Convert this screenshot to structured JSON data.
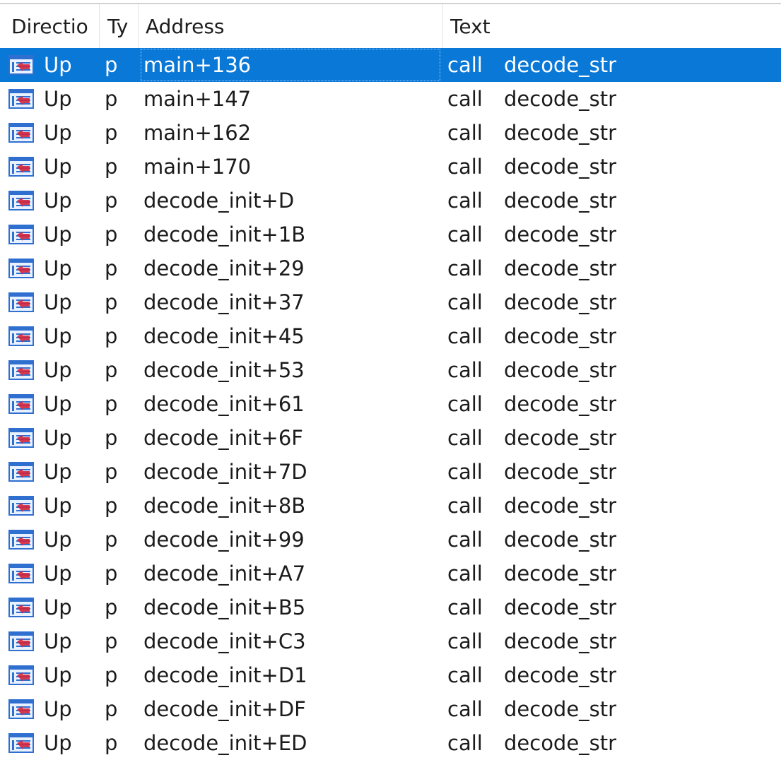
{
  "columns": {
    "direction": "Directio",
    "type": "Ty",
    "address": "Address",
    "text": "Text"
  },
  "icon": "xref-code-icon",
  "selected_index": 0,
  "rows": [
    {
      "direction": "Up",
      "type": "p",
      "address": "main+136",
      "op": "call",
      "arg": "decode_str"
    },
    {
      "direction": "Up",
      "type": "p",
      "address": "main+147",
      "op": "call",
      "arg": "decode_str"
    },
    {
      "direction": "Up",
      "type": "p",
      "address": "main+162",
      "op": "call",
      "arg": "decode_str"
    },
    {
      "direction": "Up",
      "type": "p",
      "address": "main+170",
      "op": "call",
      "arg": "decode_str"
    },
    {
      "direction": "Up",
      "type": "p",
      "address": "decode_init+D",
      "op": "call",
      "arg": "decode_str"
    },
    {
      "direction": "Up",
      "type": "p",
      "address": "decode_init+1B",
      "op": "call",
      "arg": "decode_str"
    },
    {
      "direction": "Up",
      "type": "p",
      "address": "decode_init+29",
      "op": "call",
      "arg": "decode_str"
    },
    {
      "direction": "Up",
      "type": "p",
      "address": "decode_init+37",
      "op": "call",
      "arg": "decode_str"
    },
    {
      "direction": "Up",
      "type": "p",
      "address": "decode_init+45",
      "op": "call",
      "arg": "decode_str"
    },
    {
      "direction": "Up",
      "type": "p",
      "address": "decode_init+53",
      "op": "call",
      "arg": "decode_str"
    },
    {
      "direction": "Up",
      "type": "p",
      "address": "decode_init+61",
      "op": "call",
      "arg": "decode_str"
    },
    {
      "direction": "Up",
      "type": "p",
      "address": "decode_init+6F",
      "op": "call",
      "arg": "decode_str"
    },
    {
      "direction": "Up",
      "type": "p",
      "address": "decode_init+7D",
      "op": "call",
      "arg": "decode_str"
    },
    {
      "direction": "Up",
      "type": "p",
      "address": "decode_init+8B",
      "op": "call",
      "arg": "decode_str"
    },
    {
      "direction": "Up",
      "type": "p",
      "address": "decode_init+99",
      "op": "call",
      "arg": "decode_str"
    },
    {
      "direction": "Up",
      "type": "p",
      "address": "decode_init+A7",
      "op": "call",
      "arg": "decode_str"
    },
    {
      "direction": "Up",
      "type": "p",
      "address": "decode_init+B5",
      "op": "call",
      "arg": "decode_str"
    },
    {
      "direction": "Up",
      "type": "p",
      "address": "decode_init+C3",
      "op": "call",
      "arg": "decode_str"
    },
    {
      "direction": "Up",
      "type": "p",
      "address": "decode_init+D1",
      "op": "call",
      "arg": "decode_str"
    },
    {
      "direction": "Up",
      "type": "p",
      "address": "decode_init+DF",
      "op": "call",
      "arg": "decode_str"
    },
    {
      "direction": "Up",
      "type": "p",
      "address": "decode_init+ED",
      "op": "call",
      "arg": "decode_str"
    }
  ],
  "colors": {
    "selection": "#0a78d7",
    "icon_blue": "#2f6fd0",
    "icon_red": "#d4233b"
  }
}
